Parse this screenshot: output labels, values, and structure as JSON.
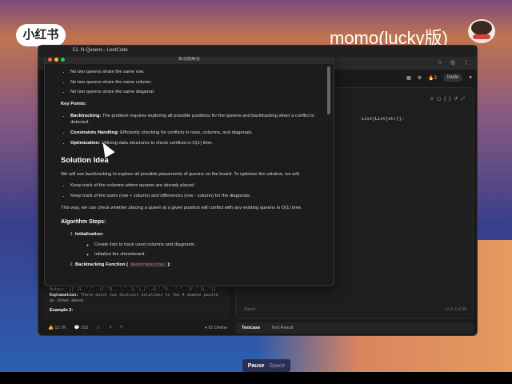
{
  "overlay": {
    "brand": "小红书",
    "username": "momo(lucky版)"
  },
  "browser": {
    "tab_title": "51. N-Queens - LeetCode",
    "header": {
      "streak": "2",
      "invite": "Invite"
    }
  },
  "editor": {
    "code_fragment": "List[List[str]]:",
    "saved": "Saved",
    "position": "Ln 3, Col 38"
  },
  "testbar": {
    "testcase": "Testcase",
    "result": "Test Result"
  },
  "description": {
    "output_line": "Output: [[\".Q..\",\"...Q\",\"Q...\",\"..Q.\"],[\"..Q.\",\"Q...\",\"...Q\",\".Q..\"]]",
    "explanation_label": "Explanation:",
    "explanation": "There exist two distinct solutions to the 4-queens puzzle as shown above",
    "example2": "Example 2:",
    "likes": "12.7K",
    "comments": "102",
    "online": "81 Online"
  },
  "popup": {
    "title": "算法题解答",
    "constraints": [
      "No two queens share the same row.",
      "No two queens share the same column.",
      "No two queens share the same diagonal."
    ],
    "key_points_title": "Key Points:",
    "key_points": [
      {
        "label": "Backtracking:",
        "text": "The problem requires exploring all possible positions for the queens and backtracking when a conflict is detected."
      },
      {
        "label": "Constraints Handling:",
        "text": "Efficiently checking for conflicts in rows, columns, and diagonals."
      },
      {
        "label": "Optimization:",
        "text": "Utilizing data structures to check conflicts in O(1) time."
      }
    ],
    "solution_title": "Solution Idea",
    "solution_intro": "We will use backtracking to explore all possible placements of queens on the board. To optimize the solution, we will:",
    "solution_points": [
      "Keep track of the columns where queens are already placed.",
      "Keep track of the sums (row + column) and differences (row - column) for the diagonals."
    ],
    "solution_outro": "This way, we can check whether placing a queen at a given position will conflict with any existing queens in O(1) time.",
    "steps_title": "Algorithm Steps:",
    "step1": "Initialization:",
    "step1_points": [
      "Create lists to track used columns and diagonals.",
      "Initialize the chessboard."
    ],
    "step2": "Backtracking Function (",
    "step2_code": "backtrack(row)",
    "step2_end": "):"
  },
  "recorder": {
    "pause": "Pause",
    "shortcut": "Space"
  }
}
